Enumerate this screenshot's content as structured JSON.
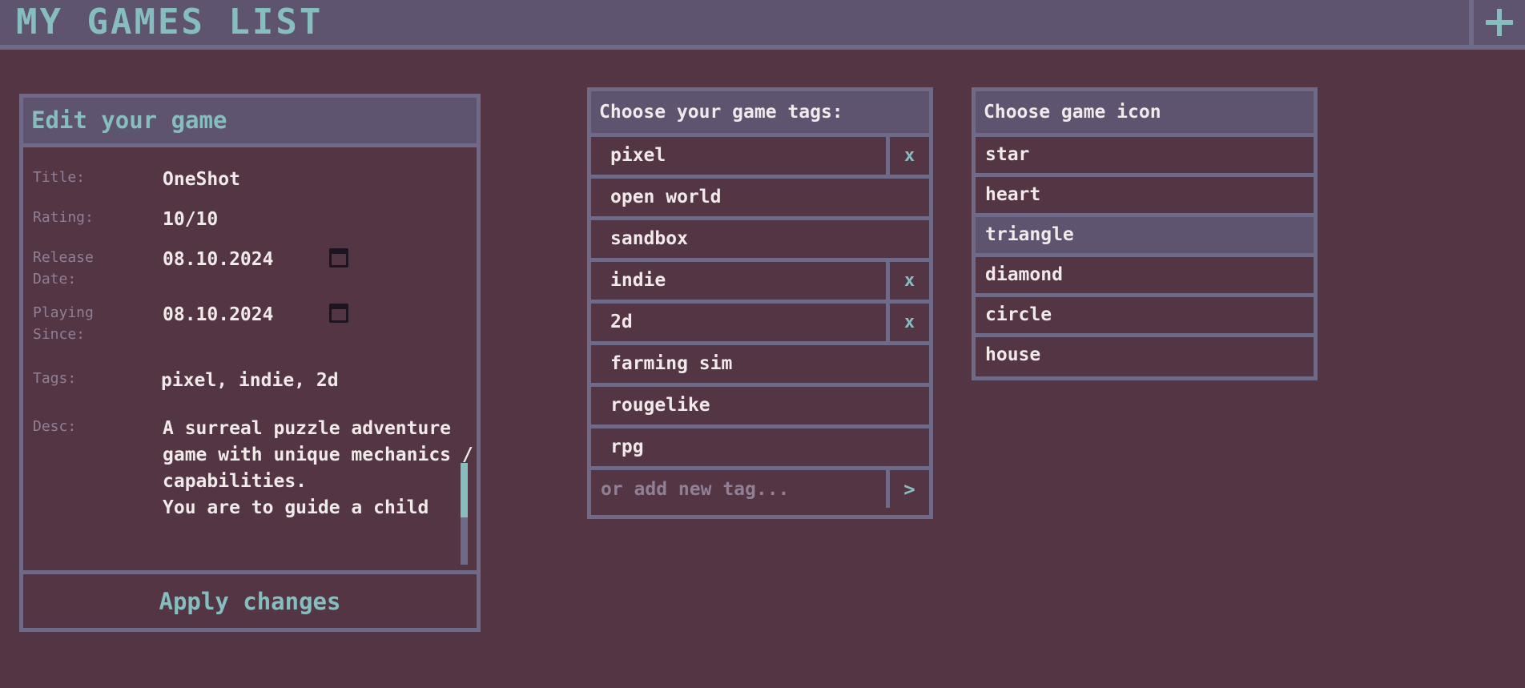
{
  "header": {
    "title": "MY GAMES LIST",
    "add_label": "+"
  },
  "edit": {
    "heading": "Edit your game",
    "fields": {
      "title_label": "Title:",
      "title_value": "OneShot",
      "rating_label": "Rating:",
      "rating_value": "10/10",
      "release_label_1": "Release",
      "release_label_2": "Date:",
      "release_value": "08.10.2024",
      "playing_label_1": "Playing",
      "playing_label_2": "Since:",
      "playing_value": "08.10.2024",
      "tags_label": "Tags:",
      "tags_value": "pixel, indie, 2d",
      "desc_label": "Desc:",
      "desc_lines": [
        "A surreal puzzle adventure",
        "game with unique mechanics /",
        "capabilities.",
        "You are to guide a child"
      ]
    },
    "apply_label": "Apply changes"
  },
  "tags": {
    "heading": "Choose your game tags:",
    "items": [
      {
        "label": "pixel",
        "selected": true,
        "remove": "x"
      },
      {
        "label": "open world",
        "selected": false
      },
      {
        "label": "sandbox",
        "selected": false
      },
      {
        "label": "indie",
        "selected": true,
        "remove": "x"
      },
      {
        "label": "2d",
        "selected": true,
        "remove": "x"
      },
      {
        "label": "farming sim",
        "selected": false
      },
      {
        "label": "rougelike",
        "selected": false
      },
      {
        "label": "rpg",
        "selected": false
      }
    ],
    "new_placeholder": "or add new tag...",
    "submit_label": ">"
  },
  "icons": {
    "heading": "Choose game icon",
    "items": [
      "star",
      "heart",
      "triangle",
      "diamond",
      "circle",
      "house"
    ],
    "selected": "triangle"
  },
  "colors": {
    "background": "#543544",
    "panel": "#5f5470",
    "border": "#6e6a88",
    "accent": "#86bec0",
    "text": "#f0eaea",
    "muted": "#8f8096"
  }
}
